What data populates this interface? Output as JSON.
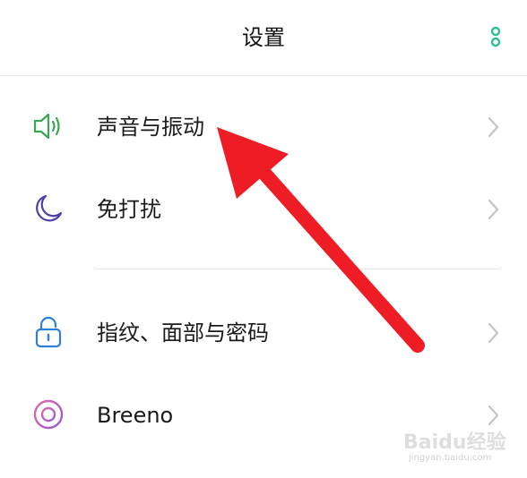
{
  "header": {
    "title": "设置",
    "more_icon": "more-vertical-icon",
    "accent_color": "#2bbf8a"
  },
  "settings": {
    "items": [
      {
        "label": "声音与振动",
        "icon": "speaker-icon",
        "icon_color": "#3aa655"
      },
      {
        "label": "免打扰",
        "icon": "moon-icon",
        "icon_color": "#4b3fa8"
      },
      {
        "label": "指纹、面部与密码",
        "icon": "lock-icon",
        "icon_color": "#2f7fd6"
      },
      {
        "label": "Breeno",
        "icon": "breeno-icon",
        "icon_color": "#b65bc4"
      }
    ]
  },
  "annotation": {
    "arrow_color": "#ee1c25"
  },
  "watermark": {
    "brand": "Baidu经验",
    "url": "jingyan.baidu.com"
  }
}
